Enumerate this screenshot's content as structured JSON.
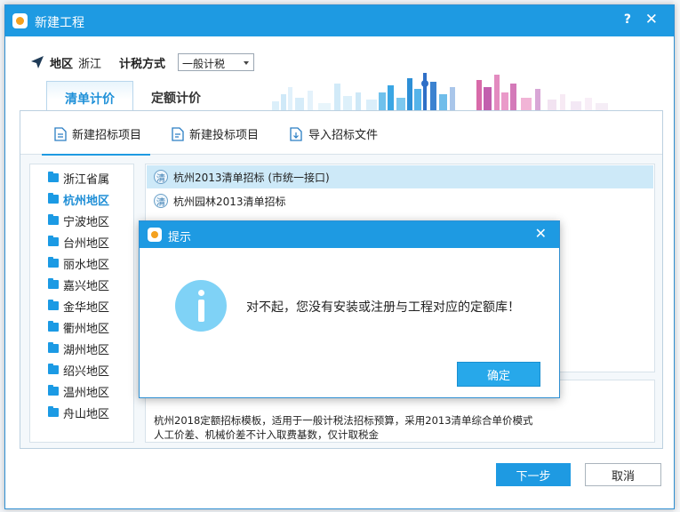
{
  "window": {
    "title": "新建工程",
    "help": "?",
    "close": "✕"
  },
  "region": {
    "label": "地区",
    "value": "浙江",
    "tax_label": "计税方式",
    "tax_value": "一般计税"
  },
  "tabs": [
    {
      "label": "清单计价",
      "active": true
    },
    {
      "label": "定额计价",
      "active": false
    }
  ],
  "toolbar": {
    "new_tender": "新建招标项目",
    "new_bid": "新建投标项目",
    "import_tender": "导入招标文件"
  },
  "regions": [
    {
      "label": "浙江省属",
      "selected": false
    },
    {
      "label": "杭州地区",
      "selected": true
    },
    {
      "label": "宁波地区",
      "selected": false
    },
    {
      "label": "台州地区",
      "selected": false
    },
    {
      "label": "丽水地区",
      "selected": false
    },
    {
      "label": "嘉兴地区",
      "selected": false
    },
    {
      "label": "金华地区",
      "selected": false
    },
    {
      "label": "衢州地区",
      "selected": false
    },
    {
      "label": "湖州地区",
      "selected": false
    },
    {
      "label": "绍兴地区",
      "selected": false
    },
    {
      "label": "温州地区",
      "selected": false
    },
    {
      "label": "舟山地区",
      "selected": false
    }
  ],
  "templates": [
    {
      "badge": "清",
      "label": "杭州2013清单招标 (市统一接口)",
      "selected": true
    },
    {
      "badge": "清",
      "label": "杭州园林2013清单招标",
      "selected": false
    }
  ],
  "description": {
    "line1": "杭州2018定额招标模板，适用于一般计税法招标预算，采用2013清单综合单价模式",
    "line2": "人工价差、机械价差不计入取费基数，仅计取税金"
  },
  "buttons": {
    "next": "下一步",
    "cancel": "取消"
  },
  "modal": {
    "title": "提示",
    "close": "✕",
    "message": "对不起，您没有安装或注册与工程对应的定额库！",
    "ok": "确定"
  }
}
